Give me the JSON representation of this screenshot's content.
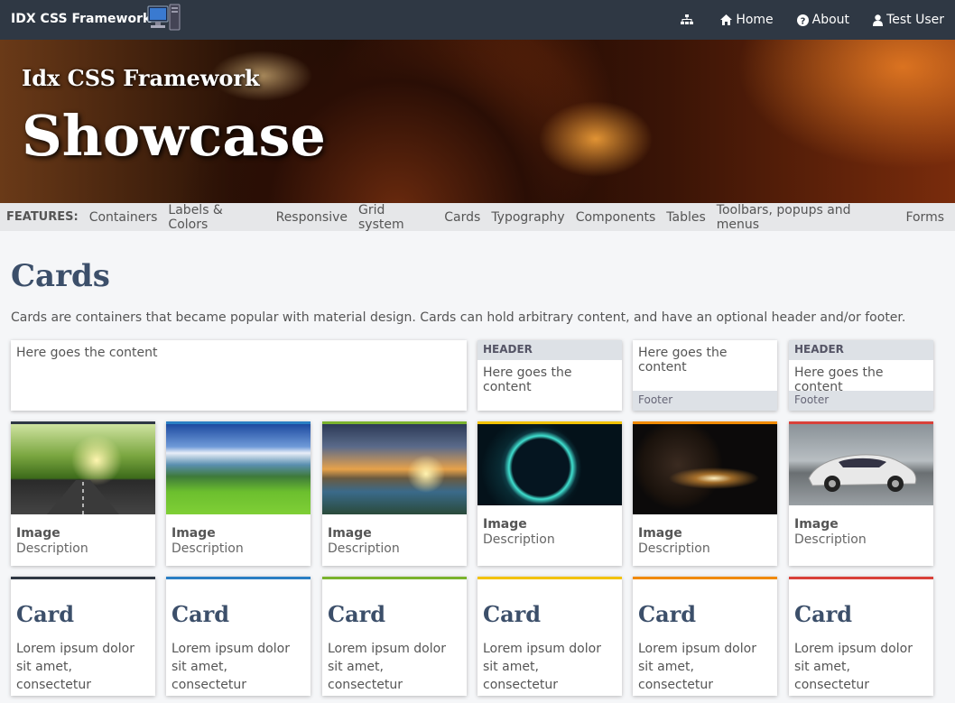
{
  "app": {
    "brand": "IDX CSS Framework",
    "nav": [
      {
        "label": "",
        "icon": "sitemap-icon"
      },
      {
        "label": "Home",
        "icon": "home-icon"
      },
      {
        "label": "About",
        "icon": "help-icon"
      },
      {
        "label": "Test User",
        "icon": "user-icon"
      }
    ]
  },
  "hero": {
    "subtitle": "Idx CSS Framework",
    "title": "Showcase"
  },
  "features": {
    "label": "FEATURES:",
    "items": [
      "Containers",
      "Labels & Colors",
      "Responsive",
      "Grid system",
      "Cards",
      "Typography",
      "Components",
      "Tables",
      "Toolbars, popups and menus",
      "Forms"
    ]
  },
  "main": {
    "title": "Cards",
    "intro": "Cards are containers that became popular with material design. Cards can hold arbitrary content, and have an optional header and/or footer.",
    "basic_cards": [
      {
        "header": "",
        "content": "Here goes the content",
        "footer": ""
      },
      {
        "header": "HEADER",
        "content": "Here goes the content",
        "footer": ""
      },
      {
        "header": "",
        "content": "Here goes the content",
        "footer": "Footer"
      },
      {
        "header": "HEADER",
        "content": "Here goes the content",
        "footer": "Footer"
      }
    ],
    "image_cards": [
      {
        "title": "Image",
        "description": "Description",
        "accent": "#2f3844"
      },
      {
        "title": "Image",
        "description": "Description",
        "accent": "#2a7fc4"
      },
      {
        "title": "Image",
        "description": "Description",
        "accent": "#7ab32e"
      },
      {
        "title": "Image",
        "description": "Description",
        "accent": "#f2c200"
      },
      {
        "title": "Image",
        "description": "Description",
        "accent": "#f08a00"
      },
      {
        "title": "Image",
        "description": "Description",
        "accent": "#d9413a"
      }
    ],
    "text_cards": [
      {
        "title": "Card",
        "body": "Lorem ipsum dolor sit amet, consectetur adipiscing elit.",
        "accent": "#2f3844"
      },
      {
        "title": "Card",
        "body": "Lorem ipsum dolor sit amet, consectetur adipiscing elit.",
        "accent": "#2a7fc4"
      },
      {
        "title": "Card",
        "body": "Lorem ipsum dolor sit amet, consectetur adipiscing elit.",
        "accent": "#7ab32e"
      },
      {
        "title": "Card",
        "body": "Lorem ipsum dolor sit amet, consectetur adipiscing elit.",
        "accent": "#f2c200"
      },
      {
        "title": "Card",
        "body": "Lorem ipsum dolor sit amet, consectetur adipiscing elit.",
        "accent": "#f08a00"
      },
      {
        "title": "Card",
        "body": "Lorem ipsum dolor sit amet, consectetur adipiscing elit.",
        "accent": "#d9413a"
      }
    ]
  }
}
